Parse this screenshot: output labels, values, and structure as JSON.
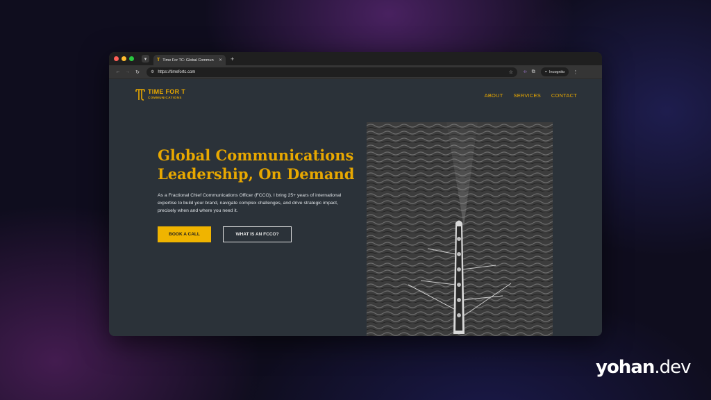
{
  "browser": {
    "tab_title": "Time For TC: Global Commun",
    "url": "https://timefortc.com",
    "incognito_label": "Incognito"
  },
  "site": {
    "logo_line1": "TIME FOR T",
    "logo_line2": "COMMUNICATIONS",
    "nav": [
      "ABOUT",
      "SERVICES",
      "CONTACT"
    ],
    "hero": {
      "title_line1": "Global Communications",
      "title_line2": "Leadership, On Demand",
      "description": "As a Fractional Chief Communications Officer (FCCO), I bring 25+ years of international expertise to build your brand, navigate complex challenges, and drive strategic impact, precisely when and where you need it.",
      "primary_button": "BOOK A CALL",
      "secondary_button": "WHAT IS AN FCCO?"
    }
  },
  "watermark": {
    "brand_bold": "yohan",
    "brand_light": ".dev"
  },
  "colors": {
    "accent": "#f0b400",
    "page_bg": "#2b3239"
  }
}
